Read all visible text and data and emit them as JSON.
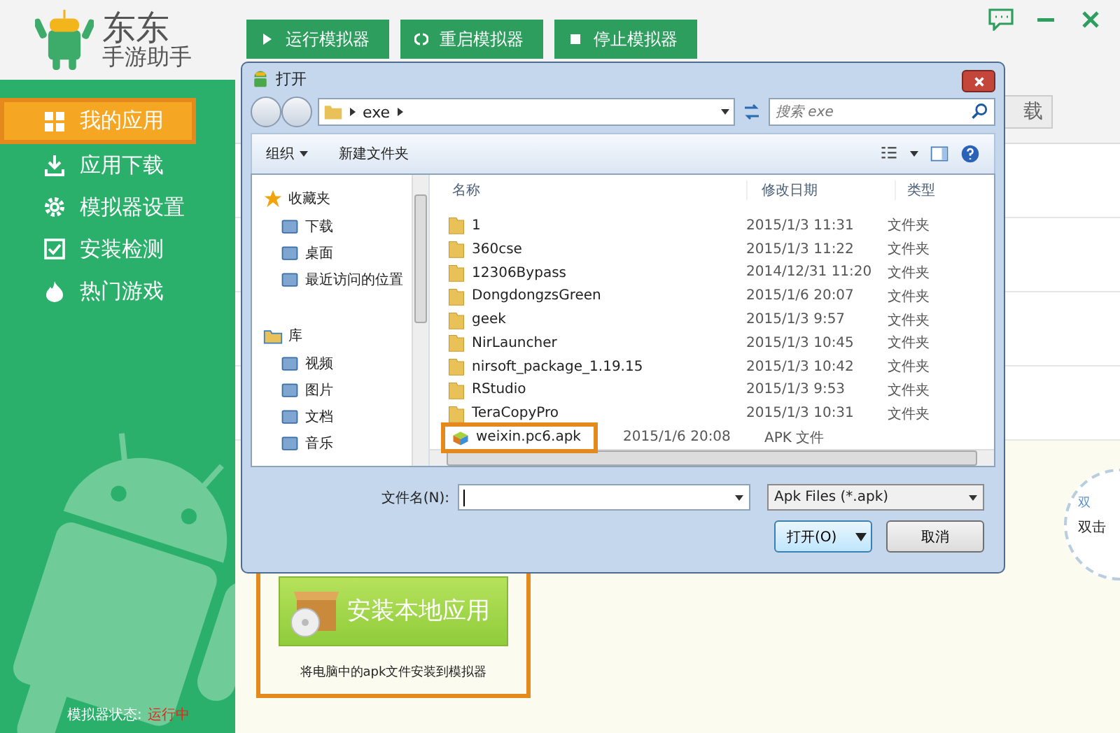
{
  "app": {
    "logo_title": "东东",
    "logo_subtitle": "手游助手"
  },
  "toolbar": [
    {
      "label": "运行模拟器"
    },
    {
      "label": "重启模拟器"
    },
    {
      "label": "停止模拟器"
    }
  ],
  "sidebar": {
    "items": [
      {
        "label": "我的应用",
        "selected": true
      },
      {
        "label": "应用下载",
        "selected": false
      },
      {
        "label": "模拟器设置",
        "selected": false
      },
      {
        "label": "安装检测",
        "selected": false
      },
      {
        "label": "热门游戏",
        "selected": false
      }
    ],
    "status_label": "模拟器状态:",
    "status_value": "运行中"
  },
  "content": {
    "partial_button": "载",
    "install_button": "安装本地应用",
    "install_caption": "将电脑中的apk文件安装到模拟器",
    "badge_texts": [
      "双",
      "双击"
    ]
  },
  "dialog": {
    "title": "打开",
    "path": [
      "exe"
    ],
    "search": {
      "placeholder": "搜索 exe"
    },
    "commands": [
      "组织",
      "新建文件夹"
    ],
    "nav": [
      {
        "label": "收藏夹",
        "children": [
          {
            "label": "下载"
          },
          {
            "label": "桌面"
          },
          {
            "label": "最近访问的位置"
          }
        ]
      },
      {
        "label": "库",
        "children": [
          {
            "label": "视频"
          },
          {
            "label": "图片"
          },
          {
            "label": "文档"
          },
          {
            "label": "音乐"
          }
        ]
      }
    ],
    "columns": [
      "名称",
      "修改日期",
      "类型"
    ],
    "files": [
      {
        "name": "1",
        "date": "2015/1/3 11:31",
        "type": "文件夹",
        "kind": "folder",
        "highlighted": false
      },
      {
        "name": "360cse",
        "date": "2015/1/3 11:22",
        "type": "文件夹",
        "kind": "folder",
        "highlighted": false
      },
      {
        "name": "12306Bypass",
        "date": "2014/12/31 11:20",
        "type": "文件夹",
        "kind": "folder",
        "highlighted": false
      },
      {
        "name": "DongdongzsGreen",
        "date": "2015/1/6 20:07",
        "type": "文件夹",
        "kind": "folder",
        "highlighted": false
      },
      {
        "name": "geek",
        "date": "2015/1/3 9:57",
        "type": "文件夹",
        "kind": "folder",
        "highlighted": false
      },
      {
        "name": "NirLauncher",
        "date": "2015/1/3 10:45",
        "type": "文件夹",
        "kind": "folder",
        "highlighted": false
      },
      {
        "name": "nirsoft_package_1.19.15",
        "date": "2015/1/3 10:42",
        "type": "文件夹",
        "kind": "folder",
        "highlighted": false
      },
      {
        "name": "RStudio",
        "date": "2015/1/3 9:53",
        "type": "文件夹",
        "kind": "folder",
        "highlighted": false
      },
      {
        "name": "TeraCopyPro",
        "date": "2015/1/3 10:31",
        "type": "文件夹",
        "kind": "folder",
        "highlighted": false
      },
      {
        "name": "weixin.pc6.apk",
        "date": "2015/1/6 20:08",
        "type": "APK 文件",
        "kind": "apk",
        "highlighted": true
      }
    ],
    "filename_label": "文件名(N):",
    "filter": "Apk Files (*.apk)",
    "open_button": "打开(O)",
    "cancel_button": "取消"
  }
}
